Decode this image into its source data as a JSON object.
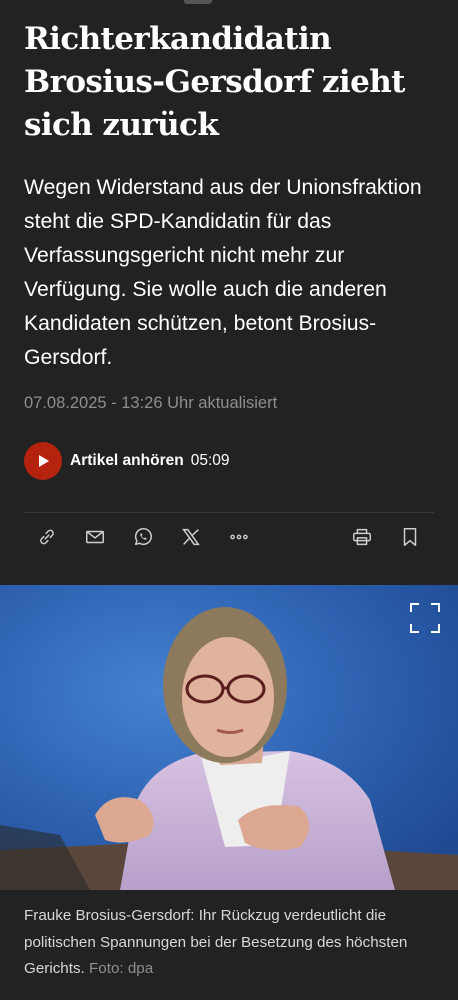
{
  "article": {
    "headline": "Richterkandidatin Brosius-Gersdorf zieht sich zurück",
    "lead": "Wegen Widerstand aus der Unionsfraktion steht die SPD-Kandidatin für das Verfassungsgericht nicht mehr zur Verfügung. Sie wolle auch die anderen Kandidaten schützen, betont Brosius-Gersdorf.",
    "timestamp": "07.08.2025 - 13:26 Uhr aktualisiert"
  },
  "audio": {
    "label": "Artikel anhören",
    "duration": "05:09",
    "accent_color": "#b5230f"
  },
  "share_bar": {
    "icons": [
      "link-icon",
      "mail-icon",
      "whatsapp-icon",
      "x-icon",
      "more-icon",
      "print-icon",
      "bookmark-icon"
    ]
  },
  "photo": {
    "caption": "Frauke Brosius-Gersdorf: Ihr Rückzug verdeutlicht die politischen Spannungen bei der Besetzung des höchsten Gerichts.",
    "credit": "Foto: dpa"
  }
}
